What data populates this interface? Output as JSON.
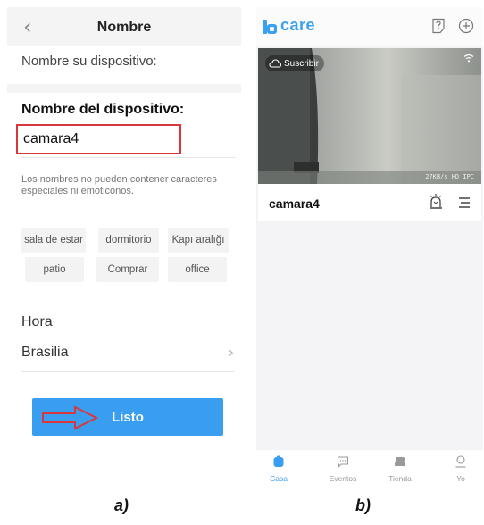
{
  "left": {
    "header": {
      "back_icon": "chevron-left-icon",
      "title": "Nombre"
    },
    "subtitle": "Nombre su dispositivo:",
    "device_name_label": "Nombre del dispositivo:",
    "device_name_value": "camara4",
    "hint": "Los nombres no pueden contener caracteres especiales ni emoticonos.",
    "suggestions": [
      "sala de estar",
      "dormitorio",
      "Kapı aralığı",
      "patio",
      "Comprar",
      "office"
    ],
    "time_label": "Hora",
    "timezone": "Brasilia",
    "done_button": "Listo",
    "highlight_color": "#d9373d",
    "accent_color": "#3a9ef0"
  },
  "right": {
    "brand": "care",
    "header_icons": [
      "help-icon",
      "add-icon"
    ],
    "camera": {
      "subscribe_label": "Suscribir",
      "bitrate": "27KB/s HD IPC",
      "name": "camara4",
      "action_icons": [
        "alarm-icon",
        "menu-icon"
      ]
    },
    "tabs": [
      {
        "label": "Casa",
        "icon": "home-icon",
        "active": true
      },
      {
        "label": "Eventos",
        "icon": "message-icon",
        "active": false
      },
      {
        "label": "Tienda",
        "icon": "store-icon",
        "active": false
      },
      {
        "label": "Yo",
        "icon": "user-icon",
        "active": false
      }
    ]
  },
  "captions": {
    "a": "a)",
    "b": "b)"
  }
}
